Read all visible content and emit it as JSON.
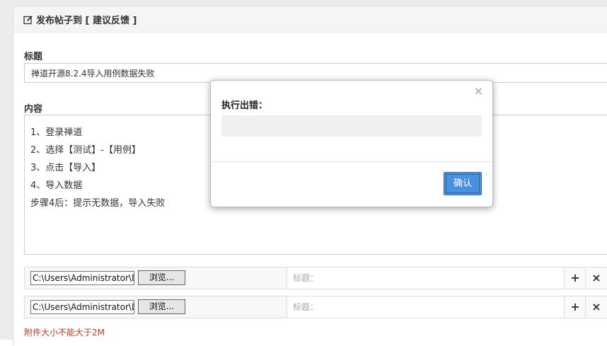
{
  "panel": {
    "title": "发布帖子到 [ 建议反馈 ]"
  },
  "form": {
    "title_label": "标题",
    "title_value": "禅道开源8.2.4导入用例数据失败",
    "content_label": "内容",
    "content_lines": [
      "1、登录禅道",
      "2、选择【测试】-【用例】",
      "3、点击【导入】",
      "4、导入数据",
      "步骤4后：提示无数据，导入失败"
    ]
  },
  "attachments": [
    {
      "file_value": "C:\\Users\\Administrator\\D",
      "browse_label": "浏览...",
      "title_placeholder": "标题：",
      "add": "+",
      "remove": "×"
    },
    {
      "file_value": "C:\\Users\\Administrator\\D",
      "browse_label": "浏览...",
      "title_placeholder": "标题：",
      "add": "+",
      "remove": "×"
    }
  ],
  "attachment_note": "附件大小不能大于2M",
  "modal": {
    "close": "×",
    "title": "执行出错：",
    "message": "",
    "ok_label": "确认"
  },
  "colors": {
    "accent": "#4a90e2",
    "warning": "#c0392b"
  }
}
